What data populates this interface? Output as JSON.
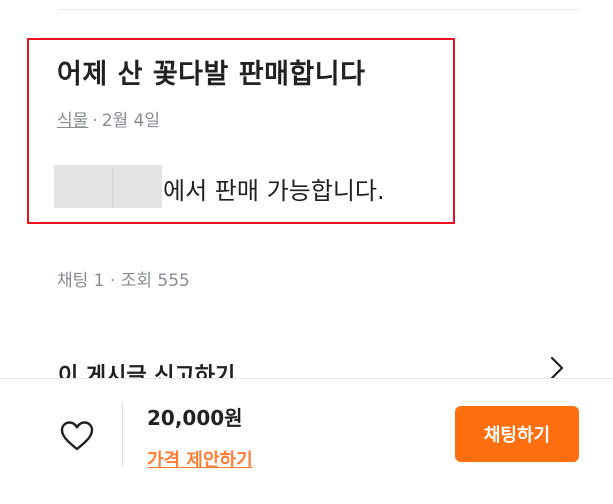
{
  "post": {
    "title": "어제 산 꽃다발 판매합니다",
    "category": "식물",
    "meta_separator": "·",
    "date": "2월 4일",
    "description_suffix": "에서 판매 가능합니다."
  },
  "stats": {
    "text": "채팅 1 · 조회 555"
  },
  "report": {
    "label": "이 게시글 신고하기"
  },
  "bottom_bar": {
    "price": "20,000원",
    "offer_label": "가격 제안하기",
    "chat_button_label": "채팅하기"
  },
  "icons": {
    "like": "heart-outline-icon",
    "report_arrow": "chevron-right-icon"
  },
  "colors": {
    "accent": "#ff6f0f",
    "offer_text": "#ff7e36",
    "highlight_border": "#e8131c",
    "meta_text": "#868b94"
  }
}
